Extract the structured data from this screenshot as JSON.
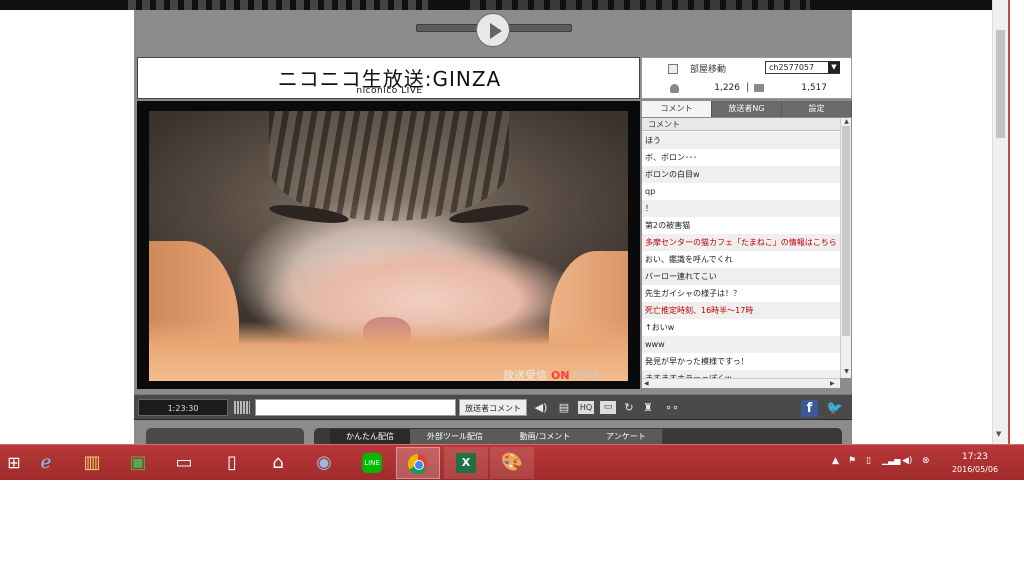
{
  "logo": {
    "main": "ニコニコ生放送:GINZA",
    "sub": "niconico LIVE"
  },
  "player": {
    "status_label": "放送受信",
    "status_on": "ON",
    "status_sep": "/",
    "status_off": "OFF",
    "time": "1:23:30"
  },
  "room": {
    "label": "部屋移動",
    "channel": "ch2577057",
    "viewers": "1,226",
    "divider": "|",
    "comments": "1,517"
  },
  "tabs": [
    {
      "label": "コメント"
    },
    {
      "label": "放送者NG"
    },
    {
      "label": "設定"
    }
  ],
  "comment_header": "コメント",
  "comments": [
    {
      "text": "ほう",
      "red": false
    },
    {
      "text": "ボ、ボロン･･･",
      "red": false
    },
    {
      "text": "ボロンの白目w",
      "red": false
    },
    {
      "text": "qp",
      "red": false
    },
    {
      "text": "！",
      "red": false
    },
    {
      "text": "第2の被害猫",
      "red": false
    },
    {
      "text": "多摩センターの猫カフェ「たまねこ」の情報はこちら",
      "red": true
    },
    {
      "text": "おい、鑑識を呼んでくれ",
      "red": false
    },
    {
      "text": "バーロー連れてこい",
      "red": false
    },
    {
      "text": "先生ガイシャの様子は！？",
      "red": false
    },
    {
      "text": "死亡推定時刻、16時半～17時",
      "red": true
    },
    {
      "text": "↑おいw",
      "red": false
    },
    {
      "text": "www",
      "red": false
    },
    {
      "text": "発見が早かった模様ですっ！",
      "red": false
    },
    {
      "text": "ますますホラーっぽくw",
      "red": false
    }
  ],
  "controls": {
    "owner_comment": "放送者コメント",
    "comment_placeholder": ""
  },
  "lower_tabs": [
    {
      "label": "かんたん配信"
    },
    {
      "label": "外部ツール配信"
    },
    {
      "label": "動画/コメント"
    },
    {
      "label": "アンケート"
    }
  ],
  "taskbar": {
    "line_label": "LINE",
    "excel_label": "X",
    "clock_time": "17:23",
    "clock_date": "2016/05/06"
  },
  "icons": {
    "start": "windows-start-icon",
    "ie": "internet-explorer-icon",
    "explorer": "file-explorer-icon",
    "store": "store-icon",
    "remote": "remote-desktop-icon",
    "file": "file-icon",
    "home": "home-icon",
    "thunderbird": "thunderbird-icon",
    "line": "line-icon",
    "chrome": "chrome-icon",
    "excel": "excel-icon",
    "paint": "paint-icon"
  },
  "colors": {
    "taskbar": "#a12b2b",
    "status_on": "#ff3b3b",
    "red_comment": "#c00000",
    "facebook": "#3b5998",
    "twitter": "#1da1f2"
  }
}
